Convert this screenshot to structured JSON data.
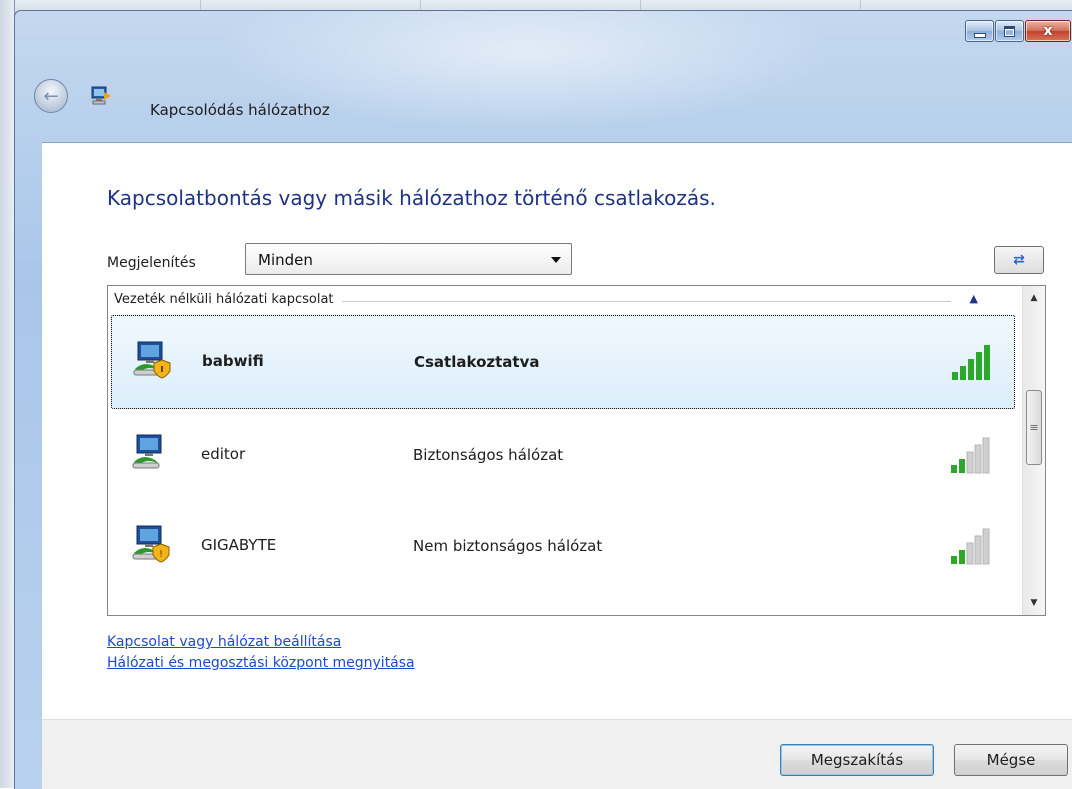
{
  "window": {
    "title": "Kapcsolódás hálózathoz",
    "caption_close": "x"
  },
  "main": {
    "heading": "Kapcsolatbontás vagy másik hálózathoz történő csatlakozás.",
    "show_label": "Megjelenítés",
    "show_select_value": "Minden"
  },
  "network_list": {
    "group_label": "Vezeték nélküli hálózati kapcsolat",
    "rows": [
      {
        "name": "babwifi",
        "status": "Csatlakoztatva",
        "selected": true,
        "signal_bars": 5
      },
      {
        "name": "editor",
        "status": "Biztonságos hálózat",
        "selected": false,
        "signal_bars": 2
      },
      {
        "name": "GIGABYTE",
        "status": "Nem biztonságos hálózat",
        "selected": false,
        "signal_bars": 2
      }
    ]
  },
  "links": {
    "setup": "Kapcsolat vagy hálózat beállítása",
    "network_center": "Hálózati és megosztási központ megnyitása"
  },
  "footer": {
    "disconnect_label": "Megszakítás",
    "cancel_label": "Mégse"
  },
  "colors": {
    "heading": "#1e3287",
    "link": "#1a4bd0",
    "signal_on": "#2ea82a",
    "signal_off": "#c8c8c8"
  }
}
